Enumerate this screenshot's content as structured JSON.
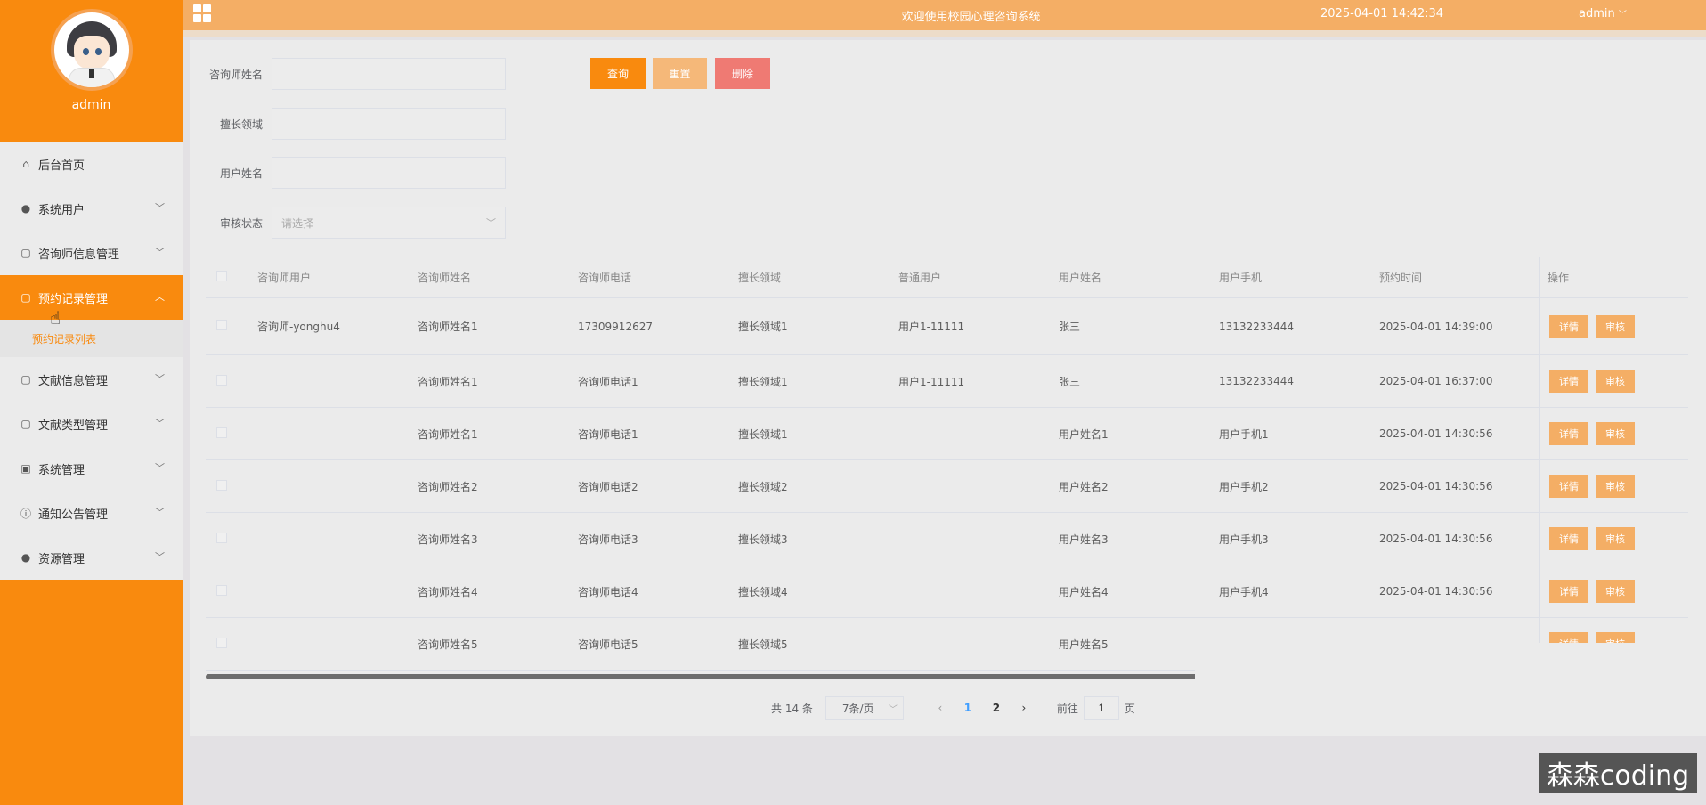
{
  "sidebar": {
    "username": "admin",
    "menu": [
      {
        "label": "后台首页",
        "icon": "home-icon"
      },
      {
        "label": "系统用户",
        "icon": "user-icon"
      },
      {
        "label": "咨询师信息管理",
        "icon": "doc-icon"
      },
      {
        "label": "预约记录管理",
        "icon": "doc-icon"
      },
      {
        "label": "文献信息管理",
        "icon": "doc-icon"
      },
      {
        "label": "文献类型管理",
        "icon": "doc-icon"
      },
      {
        "label": "系统管理",
        "icon": "picture-icon"
      },
      {
        "label": "通知公告管理",
        "icon": "info-icon"
      },
      {
        "label": "资源管理",
        "icon": "bulb-icon"
      }
    ],
    "submenu_label": "预约记录列表"
  },
  "header": {
    "title": "欢迎使用校园心理咨询系统",
    "datetime": "2025-04-01 14:42:34",
    "user": "admin"
  },
  "search": {
    "counselor_name_label": "咨询师姓名",
    "specialty_label": "擅长领域",
    "user_name_label": "用户姓名",
    "status_label": "审核状态",
    "status_placeholder": "请选择",
    "query_button": "查询",
    "reset_button": "重置",
    "delete_button": "删除"
  },
  "table": {
    "headers": [
      "咨询师用户",
      "咨询师姓名",
      "咨询师电话",
      "擅长领域",
      "普通用户",
      "用户姓名",
      "用户手机",
      "预约时间",
      "操作"
    ],
    "detail_label": "详情",
    "audit_label": "审核",
    "rows": [
      [
        "咨询师-yonghu4",
        "咨询师姓名1",
        "17309912627",
        "擅长领域1",
        "用户1-11111",
        "张三",
        "13132233444",
        "2025-04-01 14:39:00"
      ],
      [
        "",
        "咨询师姓名1",
        "咨询师电话1",
        "擅长领域1",
        "用户1-11111",
        "张三",
        "13132233444",
        "2025-04-01 16:37:00"
      ],
      [
        "",
        "咨询师姓名1",
        "咨询师电话1",
        "擅长领域1",
        "",
        "用户姓名1",
        "用户手机1",
        "2025-04-01 14:30:56"
      ],
      [
        "",
        "咨询师姓名2",
        "咨询师电话2",
        "擅长领域2",
        "",
        "用户姓名2",
        "用户手机2",
        "2025-04-01 14:30:56"
      ],
      [
        "",
        "咨询师姓名3",
        "咨询师电话3",
        "擅长领域3",
        "",
        "用户姓名3",
        "用户手机3",
        "2025-04-01 14:30:56"
      ],
      [
        "",
        "咨询师姓名4",
        "咨询师电话4",
        "擅长领域4",
        "",
        "用户姓名4",
        "用户手机4",
        "2025-04-01 14:30:56"
      ],
      [
        "",
        "咨询师姓名5",
        "咨询师电话5",
        "擅长领域5",
        "",
        "用户姓名5",
        "",
        ""
      ]
    ]
  },
  "pagination": {
    "total_text": "共 14 条",
    "page_size": "7条/页",
    "pages": [
      "1",
      "2"
    ],
    "current_page": "1",
    "goto_prefix": "前往",
    "goto_value": "1",
    "goto_suffix": "页"
  },
  "watermark": "森森coding",
  "colors": {
    "accent": "#f98a0e",
    "header": "#f4ae65",
    "reset": "#f5b879",
    "delete": "#ef7a73"
  }
}
